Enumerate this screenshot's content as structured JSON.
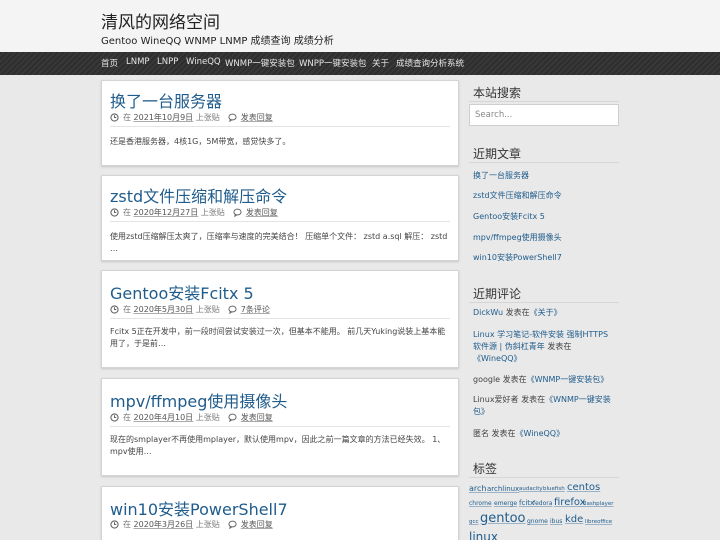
{
  "site": {
    "title": "清风的网络空间",
    "description": "Gentoo WineQQ WNMP LNMP 成绩查询 成绩分析"
  },
  "nav": [
    "首页",
    "LNMP",
    "LNPP",
    "WineQQ",
    "WNMP一键安装包",
    "WNPP一键安装包",
    "关于",
    "成绩查询分析系统"
  ],
  "posts": [
    {
      "title": "换了一台服务器",
      "date": "2021年10月9日",
      "author": "上张贴",
      "comments": "发表回复",
      "excerpt": "还是香港服务器，4核1G，5M带宽，感觉快多了。"
    },
    {
      "title": "zstd文件压缩和解压命令",
      "date": "2020年12月27日",
      "author": "上张贴",
      "comments": "发表回复",
      "excerpt": "使用zstd压缩解压太爽了，压缩率与速度的完美结合！ 压缩单个文件： zstd a.sql 解压： zstd …"
    },
    {
      "title": "Gentoo安装Fcitx 5",
      "date": "2020年5月30日",
      "author": "上张贴",
      "comments": "7条评论",
      "excerpt": "Fcitx 5正在开发中，前一段时间尝试安装过一次，但基本不能用。 前几天Yuking说装上基本能用了，于是前…"
    },
    {
      "title": "mpv/ffmpeg使用摄像头",
      "date": "2020年4月10日",
      "author": "上张贴",
      "comments": "发表回复",
      "excerpt": "现在的smplayer不再使用mplayer，默认使用mpv，因此之前一篇文章的方法已经失效。 1、mpv使用…"
    },
    {
      "title": "win10安装PowerShell7",
      "date": "2020年3月26日",
      "author": "上张贴",
      "comments": "发表回复",
      "excerpt": ""
    }
  ],
  "meta_prefix": "在",
  "sidebar": {
    "search_title": "本站搜索",
    "search_placeholder": "Search...",
    "recent_posts_title": "近期文章",
    "recent_posts": [
      "换了一台服务器",
      "zstd文件压缩和解压命令",
      "Gentoo安装Fcitx 5",
      "mpv/ffmpeg使用摄像头",
      "win10安装PowerShell7"
    ],
    "recent_comments_title": "近期评论",
    "recent_comments": [
      {
        "author": "DickWu",
        "on": "发表在",
        "post": "《关于》"
      },
      {
        "author": "Linux 学习笔记-软件安装 强制HTTPS软件源 | 伪斜杠青年",
        "on": "发表在",
        "post": "《WineQQ》"
      },
      {
        "author": "google",
        "on": "发表在",
        "post": "《WNMP一键安装包》"
      },
      {
        "author": "Linux爱好者",
        "on": "发表在",
        "post": "《WNMP一键安装包》"
      },
      {
        "author": "匿名",
        "on": "发表在",
        "post": "《WineQQ》"
      }
    ],
    "tags_title": "标签",
    "tags": [
      "arch",
      "archlinux",
      "audacity",
      "bluefish",
      "centos",
      "chrome",
      "emerge",
      "fcitx",
      "fedora",
      "firefox",
      "flashplayer",
      "gcc",
      "gentoo",
      "gnome",
      "ibus",
      "kde",
      "libreoffice",
      "linux"
    ]
  },
  "colors": {
    "link": "#1f5c8c",
    "navbar": "#333333",
    "background": "#e9e9e9"
  }
}
